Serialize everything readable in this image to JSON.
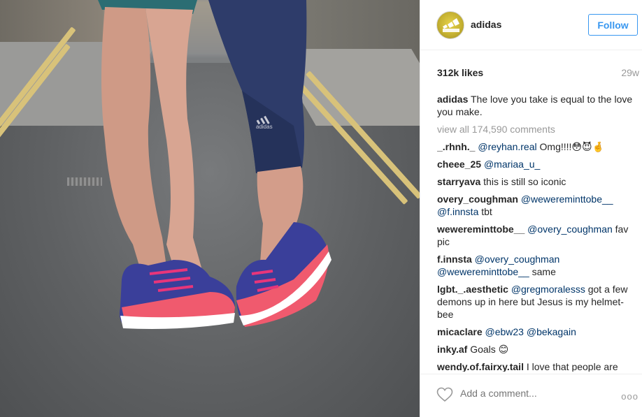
{
  "post": {
    "image": {
      "subject": "two pairs of legs on a street, one wearing Adidas sneakers and leggings",
      "leggings_logo": "adidas"
    },
    "header": {
      "username": "adidas",
      "follow_label": "Follow"
    },
    "likes": "312k likes",
    "age": "29w",
    "caption": {
      "user": "adidas",
      "text": "The love you take is equal to the love you make."
    },
    "view_all": "view all 174,590 comments",
    "comments": [
      {
        "user": "_.rhnh._",
        "mentions": [
          "@reyhan.real"
        ],
        "text": " Omg!!!!😳😈🤞"
      },
      {
        "user": "cheee_25",
        "mentions": [
          "@mariaa_u_"
        ],
        "text": ""
      },
      {
        "user": "starryava",
        "mentions": [],
        "text": "this is still so iconic"
      },
      {
        "user": "overy_coughman",
        "mentions": [
          "@wewereminttobe__",
          "@f.innsta"
        ],
        "text": " tbt"
      },
      {
        "user": "wewereminttobe__",
        "mentions": [
          "@overy_coughman"
        ],
        "text": " fav pic"
      },
      {
        "user": "f.innsta",
        "mentions": [
          "@overy_coughman",
          "@wewereminttobe__"
        ],
        "text": " same"
      },
      {
        "user": "lgbt._.aesthetic",
        "mentions": [
          "@gregmoralesss"
        ],
        "text": " got a few demons up in here but Jesus is my helmet-bee"
      },
      {
        "user": "micaclare",
        "mentions": [
          "@ebw23",
          "@bekagain"
        ],
        "text": ""
      },
      {
        "user": "inky.af",
        "mentions": [],
        "text": "Goals 😊"
      },
      {
        "user": "wendy.of.fairxy.tail",
        "mentions": [],
        "text": "I love that people are"
      }
    ],
    "footer": {
      "add_comment_placeholder": "Add a comment...",
      "more_label": "ooo"
    },
    "colors": {
      "accent": "#3897f0",
      "mention": "#003569",
      "muted": "#999999",
      "text": "#262626"
    },
    "icons": {
      "like": "heart-outline-icon",
      "more": "more-options-icon"
    }
  }
}
